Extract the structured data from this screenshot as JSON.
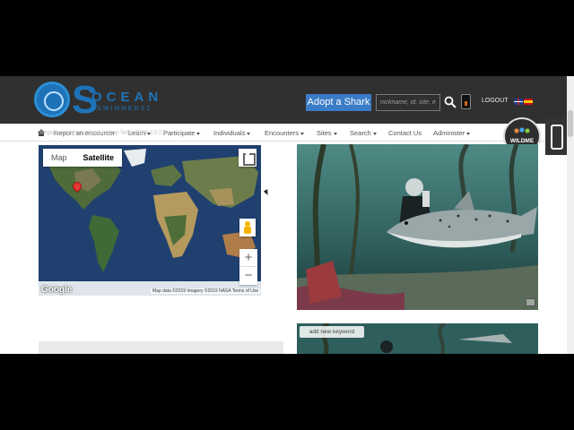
{
  "header": {
    "logo_word": "OCEAN",
    "logo_sub": "SWIMMERSZ",
    "adopt_label": "Adopt a Shark",
    "search_placeholder": "nickname, id, site, e",
    "logout_label": "LOGOUT"
  },
  "nav": {
    "items": [
      {
        "label": "Report an encounter",
        "dropdown": false
      },
      {
        "label": "Learn",
        "dropdown": true
      },
      {
        "label": "Participate",
        "dropdown": true
      },
      {
        "label": "Individuals",
        "dropdown": true
      },
      {
        "label": "Encounters",
        "dropdown": true
      },
      {
        "label": "Sites",
        "dropdown": true
      },
      {
        "label": "Search",
        "dropdown": true
      },
      {
        "label": "Contact Us",
        "dropdown": false
      },
      {
        "label": "Administer",
        "dropdown": true
      }
    ],
    "ghost_text": "Report an encounter     Lookup field 2019 13:23"
  },
  "wildme": {
    "label": "WILDME",
    "sub": "wildme.org"
  },
  "map": {
    "tab_map": "Map",
    "tab_satellite": "Satellite",
    "active_tab": "Satellite",
    "zoom_in": "+",
    "zoom_out": "−",
    "google_label": "Google",
    "attribution": "Map data ©2019 Imagery ©2019 NASA  Terms of Use"
  },
  "photos": {
    "keyword_button": "add new keyword"
  },
  "colors": {
    "header_bg": "#303030",
    "accent": "#3a7cc7",
    "brand": "#1e73b8"
  }
}
